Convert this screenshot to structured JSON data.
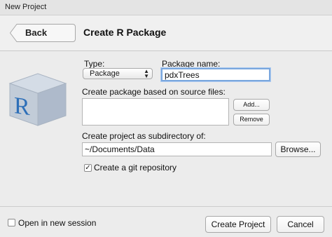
{
  "window": {
    "title": "New Project"
  },
  "header": {
    "back_label": "Back",
    "title": "Create R Package"
  },
  "form": {
    "type_label": "Type:",
    "type_value": "Package",
    "package_name_label": "Package name:",
    "package_name_value": "pdxTrees",
    "source_files_label": "Create package based on source files:",
    "add_label": "Add...",
    "remove_label": "Remove",
    "subdir_label": "Create project as subdirectory of:",
    "subdir_value": "~/Documents/Data",
    "browse_label": "Browse...",
    "git_label": "Create a git repository",
    "git_checked": true
  },
  "footer": {
    "new_session_label": "Open in new session",
    "new_session_checked": false,
    "create_label": "Create Project",
    "cancel_label": "Cancel"
  },
  "icons": {
    "logo": "r-package-box-icon",
    "git_check": "checkmark-icon",
    "select_arrows": "up-down-arrows-icon"
  },
  "colors": {
    "focus_ring": "#7aa7de",
    "logo_box": "#b9c4d2",
    "logo_letter": "#2d6fb8"
  }
}
